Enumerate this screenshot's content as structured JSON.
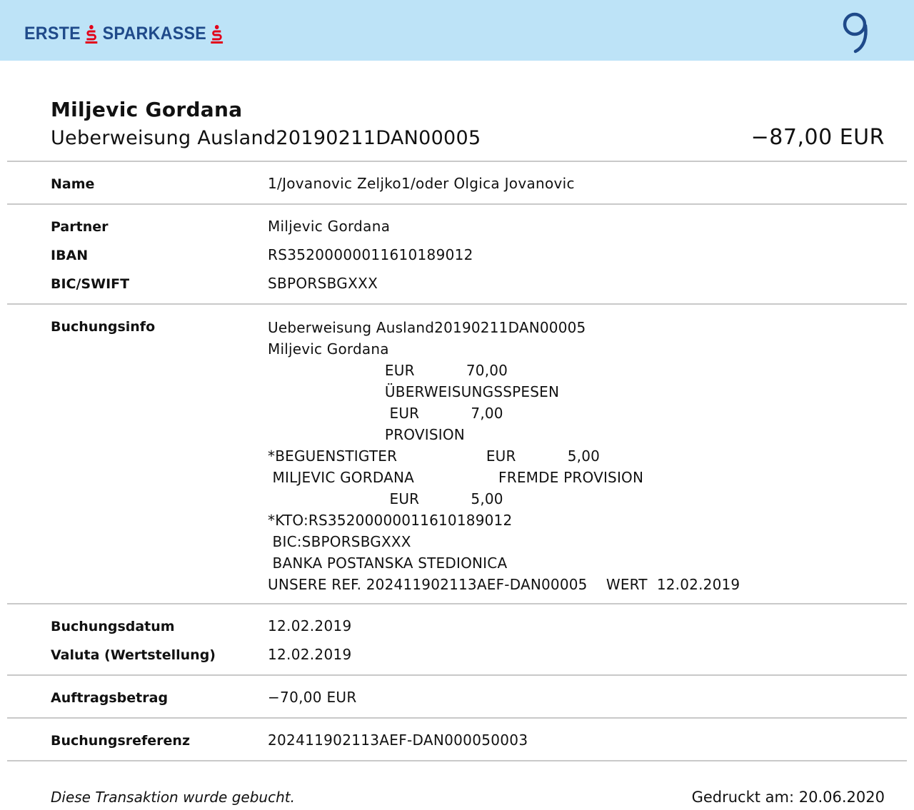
{
  "header": {
    "bank_logo_word1": "ERSTE",
    "bank_logo_word2": "SPARKASSE",
    "brand_color": "#1f4a8a",
    "accent_red": "#e2001a",
    "header_bg": "#bde3f7",
    "app_icon": "george-logo-icon"
  },
  "transaction": {
    "party_name": "Miljevic Gordana",
    "subtitle": "Ueberweisung Ausland20190211DAN00005",
    "amount": "−87,00 EUR"
  },
  "details": {
    "name_label": "Name",
    "name_value": "1/Jovanovic Zeljko1/oder Olgica Jovanovic",
    "partner_label": "Partner",
    "partner_value": "Miljevic Gordana",
    "iban_label": "IBAN",
    "iban_value": "RS35200000011610189012",
    "bic_label": "BIC/SWIFT",
    "bic_value": "SBPORSBGXXX",
    "buchungsinfo_label": "Buchungsinfo",
    "buchungsinfo_lines": [
      "Ueberweisung Ausland20190211DAN00005",
      "Miljevic Gordana",
      "                         EUR           70,00",
      "                         ÜBERWEISUNGSSPESEN",
      "                          EUR           7,00",
      "                         PROVISION",
      "*BEGUENSTIGTER                   EUR           5,00",
      " MILJEVIC GORDANA                  FREMDE PROVISION",
      "                          EUR           5,00",
      "*KTO:RS35200000011610189012",
      " BIC:SBPORSBGXXX",
      " BANKA POSTANSKA STEDIONICA",
      "UNSERE REF. 202411902113AEF-DAN00005    WERT  12.02.2019"
    ],
    "buchungsdatum_label": "Buchungsdatum",
    "buchungsdatum_value": "12.02.2019",
    "valuta_label": "Valuta (Wertstellung)",
    "valuta_value": "12.02.2019",
    "auftragsbetrag_label": "Auftragsbetrag",
    "auftragsbetrag_value": "−70,00 EUR",
    "buchungsreferenz_label": "Buchungsreferenz",
    "buchungsreferenz_value": "202411902113AEF-DAN000050003"
  },
  "footer": {
    "status": "Diese Transaktion wurde gebucht.",
    "printed": "Gedruckt am: 20.06.2020"
  }
}
